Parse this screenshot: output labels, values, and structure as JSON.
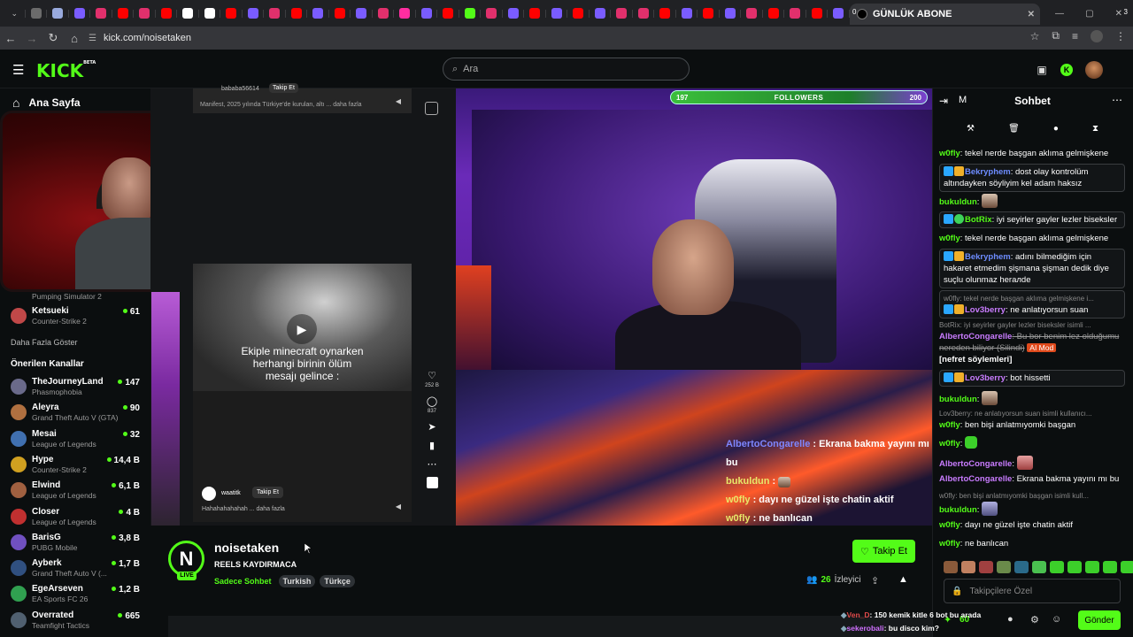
{
  "browser": {
    "active_tab_title": "GÜNLÜK ABONE",
    "active_tab_badge": "0",
    "tab_count_badge": "3",
    "url": "kick.com/noisetaken",
    "tab_favicons": [
      "#6b6b6b",
      "#9ad",
      "#7a5cff",
      "#e1306c",
      "#ff0000",
      "#e1306c",
      "#ff0000",
      "#ffffff",
      "#ffffff",
      "#ff0000",
      "#7a5cff",
      "#e1306c",
      "#ff0000",
      "#7a5cff",
      "#ff0000",
      "#7a5cff",
      "#e1306c",
      "#ff2da0",
      "#7a5cff",
      "#ff0000",
      "#53fc18",
      "#e1306c",
      "#7a5cff",
      "#ff0000",
      "#7a5cff",
      "#ff0000",
      "#7a5cff",
      "#e1306c",
      "#e1306c",
      "#ff0000",
      "#7a5cff",
      "#ff0000",
      "#7a5cff",
      "#e1306c",
      "#ff0000",
      "#e1306c",
      "#ff0000",
      "#7a5cff"
    ]
  },
  "header": {
    "logo": "KICK",
    "logo_sup": "BETA",
    "search_placeholder": "Ara"
  },
  "sidebar": {
    "home_label": "Ana Sayfa",
    "partial_top": {
      "game": "Pumping Simulator 2"
    },
    "following": [
      {
        "name": "Ketsueki",
        "game": "Counter-Strike 2",
        "viewers": "61",
        "color": "#c04848"
      }
    ],
    "more_label": "Daha Fazla Göster",
    "recommended_header": "Önerilen Kanallar",
    "recommended": [
      {
        "name": "TheJourneyLand",
        "game": "Phasmophobia",
        "viewers": "147",
        "color": "#6a6a8a"
      },
      {
        "name": "Aleyra",
        "game": "Grand Theft Auto V (GTA)",
        "viewers": "90",
        "color": "#b07040"
      },
      {
        "name": "Mesai",
        "game": "League of Legends",
        "viewers": "32",
        "color": "#4070b0"
      },
      {
        "name": "Hype",
        "game": "Counter-Strike 2",
        "viewers": "14,4 B",
        "color": "#d0a020"
      },
      {
        "name": "Elwind",
        "game": "League of Legends",
        "viewers": "6,1 B",
        "color": "#a06040"
      },
      {
        "name": "Closer",
        "game": "League of Legends",
        "viewers": "4 B",
        "color": "#c03030"
      },
      {
        "name": "BarisG",
        "game": "PUBG Mobile",
        "viewers": "3,8 B",
        "color": "#7050c0"
      },
      {
        "name": "Ayberk",
        "game": "Grand Theft Auto V (...",
        "viewers": "1,7 B",
        "color": "#305080"
      },
      {
        "name": "EgeArseven",
        "game": "EA Sports FC 26",
        "viewers": "1,2 B",
        "color": "#30a050"
      },
      {
        "name": "Overrated",
        "game": "Teamfight Tactics",
        "viewers": "665",
        "color": "#506070"
      }
    ]
  },
  "feed": {
    "top_user": "bababa56614",
    "top_follow": "Takip Et",
    "top_desc": "Manifest, 2025 yılında Türkiye'de kurulan, altı ... daha fazla",
    "video_caption_1": "Ekiple minecraft oynarken",
    "video_caption_2": "herhangi birinin ölüm",
    "video_caption_3": "mesajı gelince :",
    "bottom_user": "waatitk",
    "bottom_follow": "Takip Et",
    "bottom_desc": "Hahahahahahah ... daha fazla",
    "likes": "252 B",
    "comments": "837"
  },
  "stream": {
    "followers_left": "197",
    "followers_label": "FOLLOWERS",
    "followers_right": "200",
    "overlay_chat": [
      {
        "user": "AlbertoCongarelle",
        "text": " : Ekrana bakma yayını mı bu"
      },
      {
        "user": "bukuldun",
        "text": " :"
      },
      {
        "user": "w0fly",
        "text": " : dayı ne güzel işte chatin aktif"
      },
      {
        "user": "w0fly",
        "text": " : ne banlıcan"
      }
    ]
  },
  "channel": {
    "avatar_letter": "N",
    "live": "LIVE",
    "name": "noisetaken",
    "title": "REELS KAYDIRMACA",
    "mode": "Sadece Sohbet",
    "tags": [
      "Turkish",
      "Türkçe"
    ],
    "follow_label": "Takip Et",
    "viewers": "26",
    "viewers_label": "İzleyici"
  },
  "chat": {
    "header": "Sohbet",
    "header_left": "M",
    "input_placeholder": "Takipçilere Özel",
    "send_label": "Gönder",
    "points": "60",
    "messages": {
      "m1_user": "w0fly",
      "m1_text": ": tekel nerde başgan aklıma gelmişkene",
      "m2_user": "Bekryphem",
      "m2_text": ": dost olay kontrolüm altındayken söyliyim kel adam haksız",
      "m3_user": "bukuldun",
      "m3_text": ":",
      "m4_user": "BotRix",
      "m4_text": ": iyi seyirler gayler lezler biseksler",
      "m5_user": "w0fly",
      "m5_text": ": tekel nerde başgan aklıma gelmişkene",
      "m6_user": "Bekryphem",
      "m6_text": ": adını bilmediğim için hakaret etmedim şişmana şişman dedik diye suçlu olunmaz herалde",
      "m7_reply": "w0fly: tekel nerde başgan aklıma gelmişkene i...",
      "m7_user": "Lov3berry",
      "m7_text": ": ne anlatıyorsun suan",
      "m8_reply": "BotRix: iyi seyirler gayler lezler biseksler isimli ...",
      "m8_user": "AlbertoCongarelle",
      "m8_text": ": Bu bor benim lez olduğumu nereden biliyor (Silindi)",
      "m8_badge": "AI Mod",
      "m8_tag": "[nefret söylemleri]",
      "m9_user": "Lov3berry",
      "m9_text": ": bot hissetti",
      "m10_user": "bukuldun",
      "m10_text": ":",
      "m11_reply": "Lov3berry: ne anlatıyorsun suan isimli kullanıcı...",
      "m11_user": "w0fly",
      "m11_text": ": ben bişi anlatmıyomki başgan",
      "m12_user": "w0fly",
      "m12_text": ":",
      "m13_user": "AlbertoCongarelle",
      "m13_text": ":",
      "m14_user": "AlbertoCongarelle",
      "m14_text": ": Ekrana bakma yayını mı bu",
      "m15_reply": "w0fly: ben bişi anlatmıyomki başgan isimli kull...",
      "m15_user": "bukuldun",
      "m15_text": ":",
      "m16_user": "w0fly",
      "m16_text": ": dayı ne güzel işte chatin aktif",
      "m17_user": "w0fly",
      "m17_text": ": ne banlıcan"
    }
  },
  "bottom_overlay": {
    "l1_user": "Ven_D",
    "l1_text": ": 150 kemik kitle 6 bot bu arada",
    "l2_user": "sekerobali",
    "l2_text": ": bu disco kim?"
  }
}
